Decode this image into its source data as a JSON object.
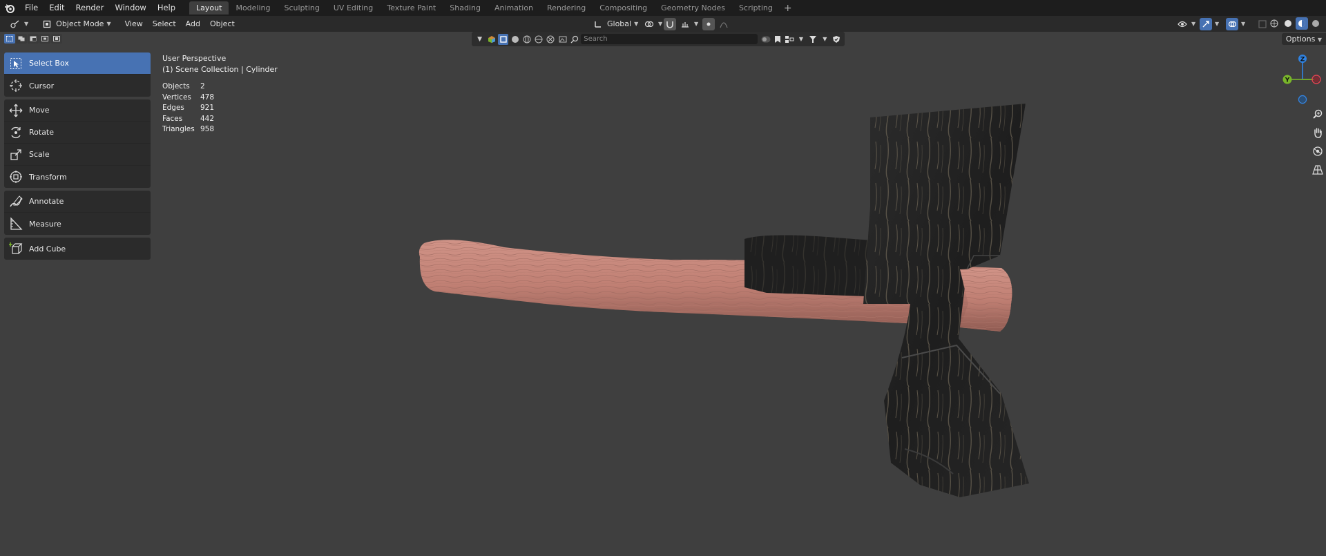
{
  "topbar": {
    "menus": [
      "File",
      "Edit",
      "Render",
      "Window",
      "Help"
    ],
    "workspaces": [
      "Layout",
      "Modeling",
      "Sculpting",
      "UV Editing",
      "Texture Paint",
      "Shading",
      "Animation",
      "Rendering",
      "Compositing",
      "Geometry Nodes",
      "Scripting"
    ],
    "active_workspace": "Layout",
    "add_symbol": "+"
  },
  "header": {
    "mode": "Object Mode",
    "view": "View",
    "select": "Select",
    "add": "Add",
    "object": "Object",
    "orientation": "Global"
  },
  "tools": {
    "select_box": "Select Box",
    "cursor": "Cursor",
    "move": "Move",
    "rotate": "Rotate",
    "scale": "Scale",
    "transform": "Transform",
    "annotate": "Annotate",
    "measure": "Measure",
    "add_cube": "Add Cube"
  },
  "viewport": {
    "perspective": "User Perspective",
    "collection": "(1) Scene Collection | Cylinder",
    "stats": [
      {
        "label": "Objects",
        "value": "2"
      },
      {
        "label": "Vertices",
        "value": "478"
      },
      {
        "label": "Edges",
        "value": "921"
      },
      {
        "label": "Faces",
        "value": "442"
      },
      {
        "label": "Triangles",
        "value": "958"
      }
    ],
    "search_placeholder": "Search",
    "options": "Options"
  },
  "gizmo": {
    "z": "Z",
    "y": "Y",
    "colors": {
      "z": "#2f83e3",
      "y": "#79b62a",
      "x": "#e0414f"
    }
  },
  "colors": {
    "accent": "#4772b3",
    "viewport_bg": "#3f3f3f",
    "handle": "#c98578",
    "axe_head": "#242424"
  }
}
